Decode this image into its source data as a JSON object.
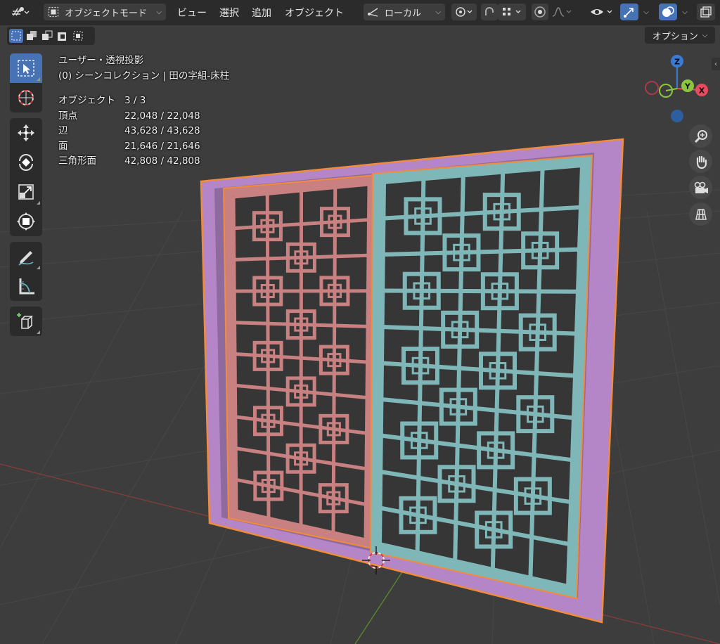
{
  "header": {
    "mode_label": "オブジェクトモード",
    "menu": [
      "ビュー",
      "選択",
      "追加",
      "オブジェクト"
    ],
    "transform_orientation": "ローカル",
    "options_label": "オプション"
  },
  "overlay": {
    "view_name": "ユーザー・透視投影",
    "collection": "(0) シーンコレクション | 田の字組-床柱",
    "stats": [
      {
        "label": "オブジェクト",
        "value": "3 / 3"
      },
      {
        "label": "頂点",
        "value": "22,048 / 22,048"
      },
      {
        "label": "辺",
        "value": "43,628 / 43,628"
      },
      {
        "label": "面",
        "value": "21,646 / 21,646"
      },
      {
        "label": "三角形面",
        "value": "42,808 / 42,808"
      }
    ]
  },
  "gizmo": {
    "z_label": "Z",
    "y_label": "Y",
    "x_label": "X",
    "colors": {
      "x": "#e84a5f",
      "y": "#8cc63f",
      "z": "#3a7bd5"
    }
  },
  "colors": {
    "accent": "#4772b3",
    "frame": "#b586c7",
    "left_panel": "#c88080",
    "right_panel": "#7fb7b8",
    "outline": "#f08c3c"
  },
  "icons": {
    "toolbar": [
      "select-box-icon",
      "cursor-icon",
      "move-icon",
      "rotate-icon",
      "scale-icon",
      "transform-icon",
      "annotate-icon",
      "measure-icon",
      "add-cube-icon"
    ],
    "nav": [
      "zoom-icon",
      "hand-icon",
      "camera-icon",
      "grid-icon"
    ]
  }
}
